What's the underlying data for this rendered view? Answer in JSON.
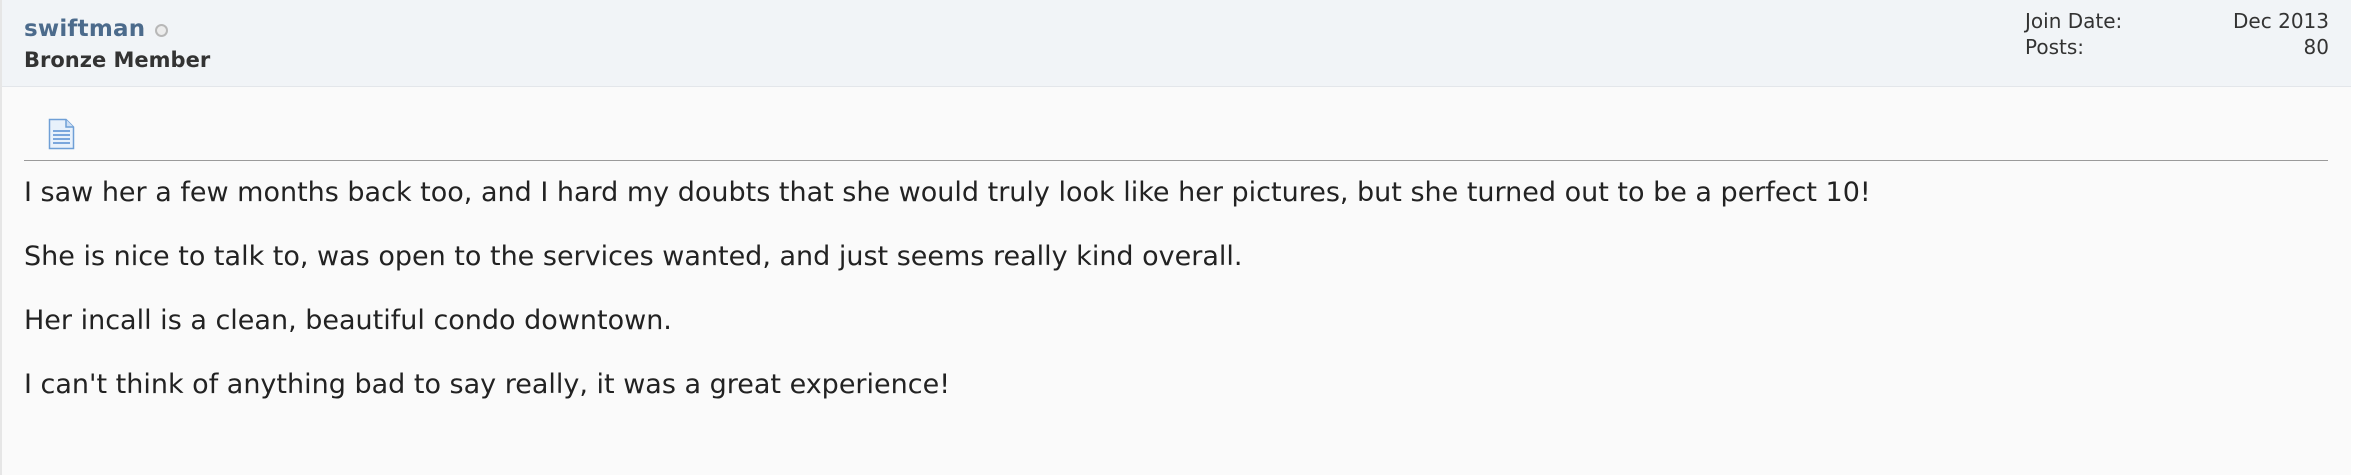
{
  "user": {
    "name": "swiftman",
    "title": "Bronze Member",
    "online_status": "offline"
  },
  "stats": {
    "join_date_label": "Join Date:",
    "join_date_value": "Dec 2013",
    "posts_label": "Posts:",
    "posts_value": "80"
  },
  "post": {
    "icon": "document-icon",
    "paragraphs": [
      "I saw her a few months back too, and I hard my doubts that she would truly look like her pictures, but she turned out to be a perfect 10!",
      "She is nice to talk to, was open to the services wanted, and just seems really kind overall.",
      "Her incall is a clean, beautiful condo downtown.",
      "I can't think of anything bad to say really, it was a great experience!"
    ]
  },
  "colors": {
    "username": "#4c6b8c",
    "header_bg": "#f1f4f7",
    "body_bg": "#fafafa",
    "text": "#222222"
  }
}
